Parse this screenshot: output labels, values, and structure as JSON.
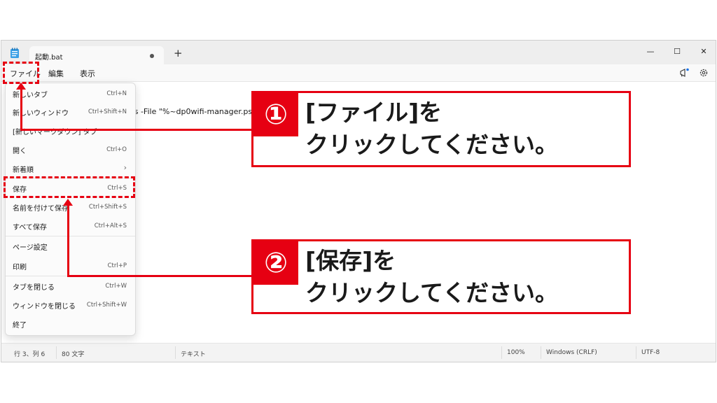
{
  "window": {
    "tab_title": "起動.bat",
    "new_tab_symbol": "+",
    "controls": {
      "minimize": "—",
      "maximize": "☐",
      "close": "✕"
    }
  },
  "menubar": {
    "file": "ファイル",
    "edit": "編集",
    "view": "表示"
  },
  "editor": {
    "visible_line_fragment": "ss -File \"%~dp0wifi-manager.ps"
  },
  "file_menu": {
    "items": [
      {
        "label": "新しいタブ",
        "shortcut": "Ctrl+N"
      },
      {
        "label": "新しいウィンドウ",
        "shortcut": "Ctrl+Shift+N"
      },
      {
        "label": "[新しいマークダウン] タブ",
        "shortcut": ""
      },
      {
        "label": "開く",
        "shortcut": "Ctrl+O"
      },
      {
        "label": "新着順",
        "shortcut": ""
      },
      {
        "label": "保存",
        "shortcut": "Ctrl+S"
      },
      {
        "label": "名前を付けて保存",
        "shortcut": "Ctrl+Shift+S"
      },
      {
        "label": "すべて保存",
        "shortcut": "Ctrl+Alt+S"
      },
      {
        "label": "ページ設定",
        "shortcut": ""
      },
      {
        "label": "印刷",
        "shortcut": "Ctrl+P"
      },
      {
        "label": "タブを閉じる",
        "shortcut": "Ctrl+W"
      },
      {
        "label": "ウィンドウを閉じる",
        "shortcut": "Ctrl+Shift+W"
      },
      {
        "label": "終了",
        "shortcut": ""
      }
    ],
    "submenu_arrow": "›"
  },
  "statusbar": {
    "position": "行 3、列 6",
    "char_count": "80 文字",
    "format": "テキスト",
    "zoom": "100%",
    "line_ending": "Windows (CRLF)",
    "encoding": "UTF-8"
  },
  "callouts": {
    "step1": {
      "number": "①",
      "line1": "[ファイル]を",
      "line2": "クリックしてください。"
    },
    "step2": {
      "number": "②",
      "line1": "[保存]を",
      "line2": "クリックしてください。"
    }
  },
  "colors": {
    "highlight": "#e60012"
  }
}
